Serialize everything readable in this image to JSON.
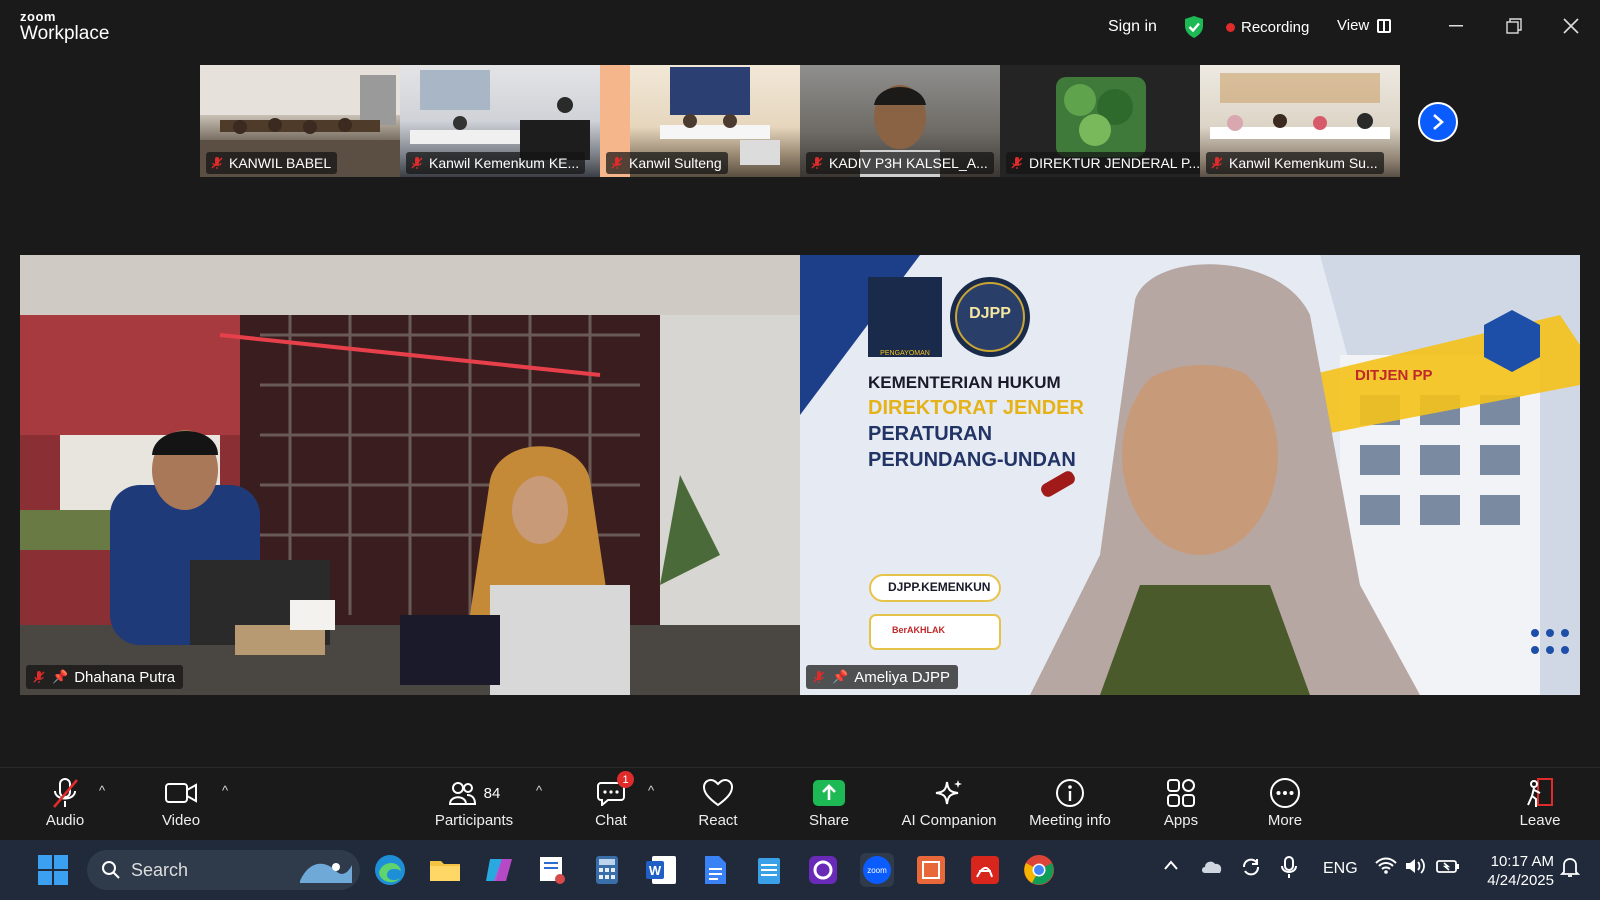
{
  "app": {
    "logo_line1": "zoom",
    "logo_line2": "Workplace"
  },
  "header": {
    "sign_in": "Sign in",
    "recording": "Recording",
    "view": "View"
  },
  "thumbnails": [
    {
      "name": "KANWIL BABEL"
    },
    {
      "name": "Kanwil Kemenkum KE..."
    },
    {
      "name": "Kanwil Sulteng"
    },
    {
      "name": "KADIV P3H KALSEL_A..."
    },
    {
      "name": "DIREKTUR JENDERAL P..."
    },
    {
      "name": "Kanwil Kemenkum Su..."
    }
  ],
  "main_videos": [
    {
      "name": "Dhahana Putra"
    },
    {
      "name": "Ameliya DJPP",
      "bg_logo": "DJPP",
      "bg_logo_caption": "PENGAYOMAN",
      "bg_line1": "KEMENTERIAN HUKUM",
      "bg_line2": "DIREKTORAT JENDER",
      "bg_line3": "PERATURAN",
      "bg_line4": "PERUNDANG-UNDAN",
      "bg_url": "DJPP.KEMENKUN",
      "bg_building": "DITJEN PP",
      "bg_badge": "BerAKHLAK"
    }
  ],
  "toolbar": {
    "audio": "Audio",
    "video": "Video",
    "participants": "Participants",
    "participants_count": "84",
    "chat": "Chat",
    "chat_badge": "1",
    "react": "React",
    "share": "Share",
    "ai_companion": "AI Companion",
    "meeting_info": "Meeting info",
    "apps": "Apps",
    "more": "More",
    "leave": "Leave"
  },
  "taskbar": {
    "search": "Search",
    "language": "ENG",
    "time": "10:17 AM",
    "date": "4/24/2025"
  },
  "colors": {
    "accent": "#0b5cff",
    "recording": "#e02b2b",
    "share": "#1db954",
    "mute": "#e02b2b"
  }
}
